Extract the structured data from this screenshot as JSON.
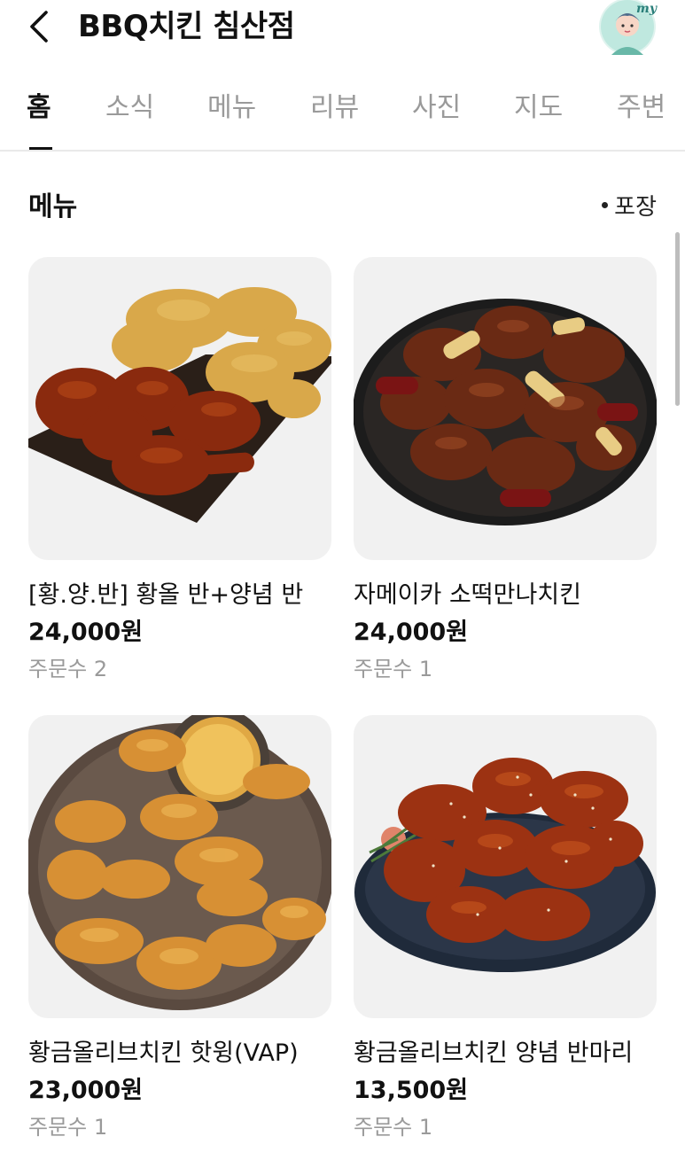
{
  "header": {
    "title": "BBQ치킨 침산점",
    "avatar_label": "my"
  },
  "tabs": [
    {
      "label": "홈",
      "active": true
    },
    {
      "label": "소식",
      "active": false
    },
    {
      "label": "메뉴",
      "active": false
    },
    {
      "label": "리뷰",
      "active": false
    },
    {
      "label": "사진",
      "active": false
    },
    {
      "label": "지도",
      "active": false
    },
    {
      "label": "주변",
      "active": false
    }
  ],
  "menu": {
    "section_title": "메뉴",
    "filter_label": "포장",
    "items": [
      {
        "name": "[황.양.반] 황올 반+양념 반",
        "price": "24,000원",
        "orders": "주문수 2",
        "image": "half-fried-half-sauced-chicken"
      },
      {
        "name": "자메이카 소떡만나치킨",
        "price": "24,000원",
        "orders": "주문수 1",
        "image": "jamaica-chicken-with-rice-cakes"
      },
      {
        "name": "황금올리브치킨 핫윙(VAP)",
        "price": "23,000원",
        "orders": "주문수 1",
        "image": "golden-olive-hot-wings"
      },
      {
        "name": "황금올리브치킨 양념 반마리",
        "price": "13,500원",
        "orders": "주문수 1",
        "image": "sauced-half-chicken"
      }
    ]
  },
  "colors": {
    "active_tab": "#111111",
    "inactive_tab": "#9a9a9a",
    "card_bg": "#f1f1f1"
  }
}
